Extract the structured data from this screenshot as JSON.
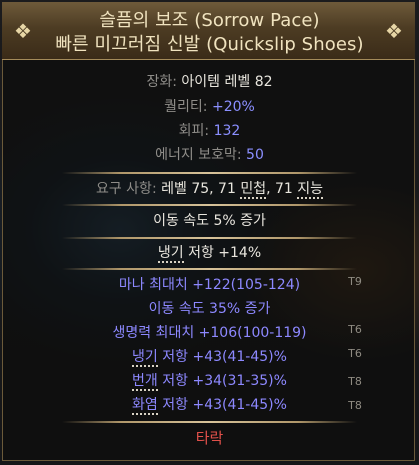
{
  "item": {
    "title_line1": "슬픔의 보조 (Sorrow Pace)",
    "title_line2": "빠른 미끄러짐 신발 (Quickslip Shoes)",
    "properties": {
      "slot_label": "장화: ",
      "level_label": "아이템 레벨 82",
      "quality_label": "퀄리티: ",
      "quality_value": "+20%",
      "evasion_label": "회피: ",
      "evasion_value": "132",
      "es_label": "에너지 보호막: ",
      "es_value": "50"
    },
    "requirements": {
      "label": "요구 사항: ",
      "level_text": "레벨 75, ",
      "dex_value": "71 ",
      "dex_label": "민첩",
      "int_value": "71 ",
      "int_label": "지능"
    },
    "enchant": "이동 속도 5% 증가",
    "implicit_prefix": "냉기",
    "implicit_suffix": " 저항 +14%",
    "explicit_mods": [
      "마나 최대치 +122(105-124)",
      "이동 속도 35% 증가",
      "생명력 최대치 +106(100-119)"
    ],
    "resist_mods": [
      {
        "keyword": "냉기",
        "rest": " 저항 +43(41-45)%"
      },
      {
        "keyword": "번개",
        "rest": " 저항 +34(31-35)%"
      },
      {
        "keyword": "화염",
        "rest": " 저항 +43(41-45)%"
      }
    ],
    "corrupted": "타락"
  },
  "background_tiers": [
    "T9",
    "T6",
    "T6",
    "T8",
    "T8"
  ]
}
